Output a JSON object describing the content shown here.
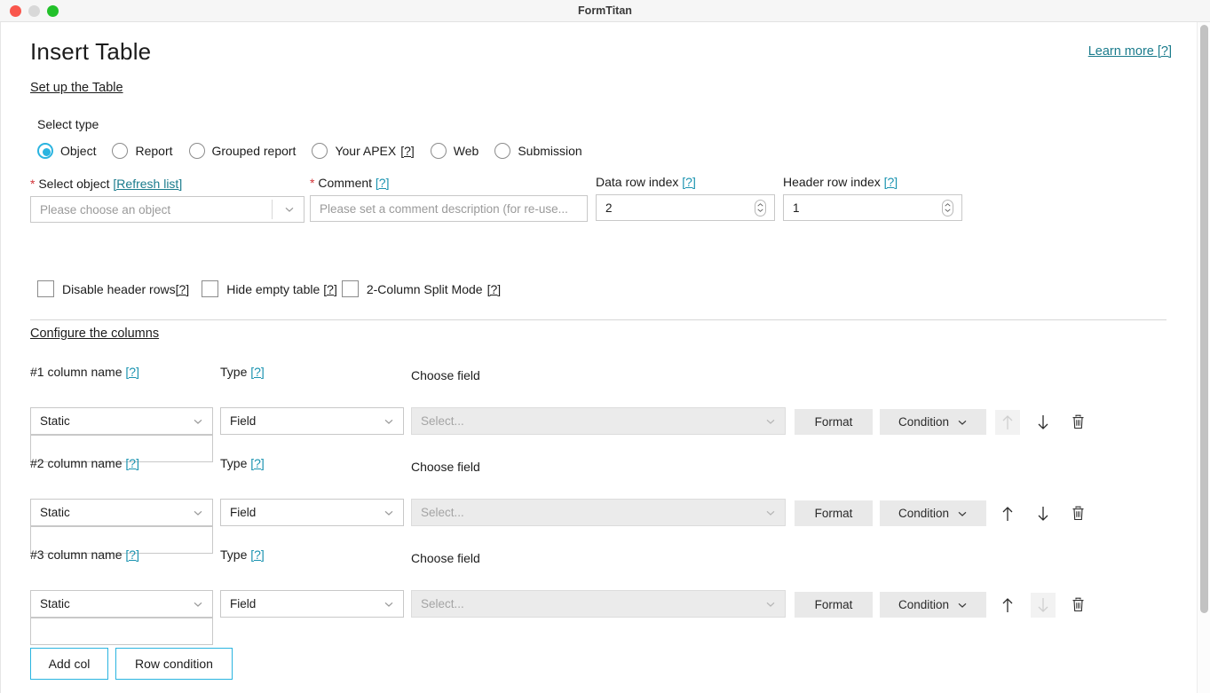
{
  "window": {
    "title": "FormTitan",
    "controls": {
      "close": "close-button",
      "minimize": "minimize-button",
      "zoom": "zoom-button"
    }
  },
  "header": {
    "page_title": "Insert Table",
    "learn_more": "Learn more [?]"
  },
  "setup": {
    "section_title": "Set up the Table",
    "select_type_label": "Select type",
    "type_options": [
      {
        "label": "Object",
        "selected": true,
        "help": ""
      },
      {
        "label": "Report",
        "selected": false,
        "help": ""
      },
      {
        "label": "Grouped report",
        "selected": false,
        "help": ""
      },
      {
        "label": "Your APEX",
        "selected": false,
        "help": "[?]"
      },
      {
        "label": "Web",
        "selected": false,
        "help": ""
      },
      {
        "label": "Submission",
        "selected": false,
        "help": ""
      }
    ],
    "select_object": {
      "required_mark": "*",
      "label": "Select object",
      "refresh_link": "[Refresh list]",
      "placeholder": "Please choose an object",
      "value": ""
    },
    "comment": {
      "required_mark": "*",
      "label": "Comment",
      "help": "[?]",
      "placeholder": "Please set a comment description (for re-use...",
      "value": ""
    },
    "data_row_index": {
      "label": "Data row index",
      "help": "[?]",
      "value": "2"
    },
    "header_row_index": {
      "label": "Header row index",
      "help": "[?]",
      "value": "1"
    },
    "checkboxes": [
      {
        "label": "Disable header rows",
        "help": "[?]",
        "checked": false,
        "gap": "0"
      },
      {
        "label": "Hide empty table",
        "help": "[?]",
        "checked": false,
        "gap": "4"
      },
      {
        "label": "2-Column Split Mode",
        "help": "[?]",
        "checked": false,
        "gap": "5"
      }
    ]
  },
  "columns_section": {
    "section_title": "Configure the columns",
    "type_label": "Type",
    "type_help": "[?]",
    "choose_field_label": "Choose field",
    "name_help": "[?]",
    "format_label": "Format",
    "condition_label": "Condition",
    "field_placeholder": "Select...",
    "rows": [
      {
        "name_label": "#1 column name",
        "source_value": "Static",
        "type_value": "Field",
        "field_value": "",
        "text_value": "",
        "up_enabled": false,
        "down_enabled": true
      },
      {
        "name_label": "#2 column name",
        "source_value": "Static",
        "type_value": "Field",
        "field_value": "",
        "text_value": "",
        "up_enabled": true,
        "down_enabled": true
      },
      {
        "name_label": "#3 column name",
        "source_value": "Static",
        "type_value": "Field",
        "field_value": "",
        "text_value": "",
        "up_enabled": true,
        "down_enabled": false
      }
    ]
  },
  "footer": {
    "add_col": "Add col",
    "row_condition": "Row condition"
  },
  "colors": {
    "accent": "#2ab4e0",
    "link": "#1a7b8c",
    "help_link": "#1a93b0",
    "required": "#d13438",
    "button_grey": "#e9e9e9"
  }
}
